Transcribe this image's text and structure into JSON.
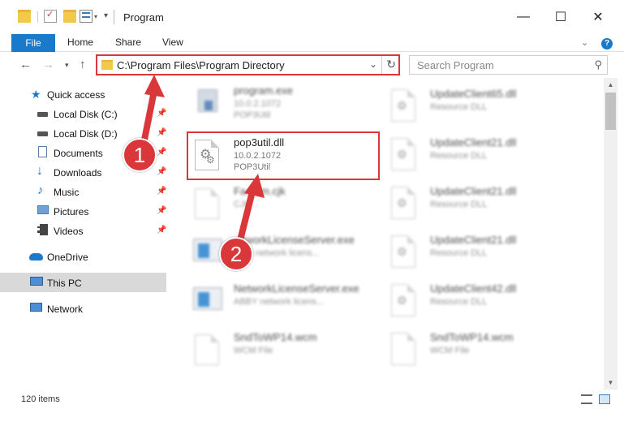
{
  "window": {
    "title": "Program",
    "minimize_glyph": "—",
    "maximize_glyph": "☐",
    "close_glyph": "✕"
  },
  "ribbon": {
    "tabs": [
      "File",
      "Home",
      "Share",
      "View"
    ],
    "expand_glyph": "⌄"
  },
  "address": {
    "path": "C:\\Program Files\\Program Directory",
    "search_placeholder": "Search Program"
  },
  "sidebar": {
    "items": [
      {
        "label": "Quick access",
        "icon": "star-icon",
        "pinned": false
      },
      {
        "label": "Local Disk (C:)",
        "icon": "drive-icon",
        "pinned": true
      },
      {
        "label": "Local Disk (D:)",
        "icon": "drive-icon",
        "pinned": true
      },
      {
        "label": "Documents",
        "icon": "documents-icon",
        "pinned": true
      },
      {
        "label": "Downloads",
        "icon": "download-icon",
        "pinned": true
      },
      {
        "label": "Music",
        "icon": "music-icon",
        "pinned": true
      },
      {
        "label": "Pictures",
        "icon": "pictures-icon",
        "pinned": true
      },
      {
        "label": "Videos",
        "icon": "videos-icon",
        "pinned": true
      },
      {
        "label": "OneDrive",
        "icon": "cloud-icon",
        "pinned": false
      },
      {
        "label": "This PC",
        "icon": "computer-icon",
        "pinned": false,
        "selected": true
      },
      {
        "label": "Network",
        "icon": "network-icon",
        "pinned": false
      }
    ]
  },
  "files": [
    {
      "name": "program.exe",
      "line2": "10.0.2.1072",
      "line3": "POP3Util",
      "icon": "exe-icon"
    },
    {
      "name": "pop3util.dll",
      "line2": "10.0.2.1072",
      "line3": "POP3Util",
      "icon": "dll-gear-icon",
      "highlighted": true
    },
    {
      "name": "Fa...em.cjk",
      "line2": "CJK...",
      "line3": "",
      "icon": "file-icon"
    },
    {
      "name": "...tworkLicenseServer.exe",
      "line2": "...BY network licens...",
      "line3": "",
      "icon": "window-app-icon"
    },
    {
      "name": "NetworkLicenseServer.exe",
      "line2": "ABBY network licens...",
      "line3": "",
      "icon": "window-app-icon"
    },
    {
      "name": "SndToWP14.wcm",
      "line2": "WCM File",
      "line3": "",
      "icon": "file-icon"
    },
    {
      "name": "UpdateClient65.dll",
      "line2": "Resource DLL",
      "line3": "",
      "icon": "dll-gear-icon"
    },
    {
      "name": "UpdateClient21.dll",
      "line2": "Resource DLL",
      "line3": "",
      "icon": "dll-gear-icon"
    },
    {
      "name": "UpdateClient21.dll",
      "line2": "Resource DLL",
      "line3": "",
      "icon": "dll-gear-icon"
    },
    {
      "name": "UpdateClient21.dll",
      "line2": "Resource DLL",
      "line3": "",
      "icon": "dll-gear-icon"
    },
    {
      "name": "UpdateClient42.dll",
      "line2": "Resource DLL",
      "line3": "",
      "icon": "dll-gear-icon"
    },
    {
      "name": "SndToWP14.wcm",
      "line2": "WCM File",
      "line3": "",
      "icon": "file-icon"
    }
  ],
  "annotations": {
    "step1": "1",
    "step2": "2",
    "accent": "#d9373a"
  },
  "status": {
    "item_count": "120 items"
  }
}
